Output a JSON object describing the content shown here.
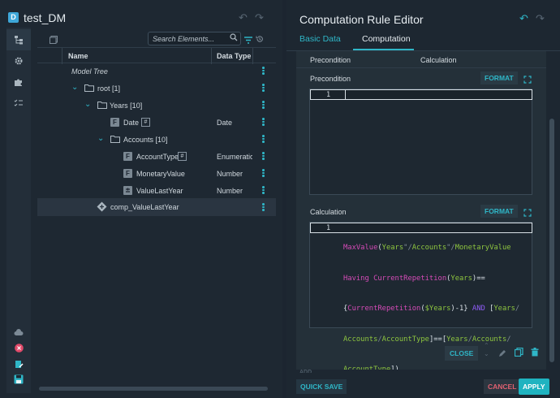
{
  "app": {
    "title": "test_DM",
    "logo_letter": "D"
  },
  "tree": {
    "search_placeholder": "Search Elements...",
    "columns": {
      "name": "Name",
      "data_type": "Data Type"
    },
    "root_label": "Model Tree",
    "rows": [
      {
        "label": "root [1]",
        "type": ""
      },
      {
        "label": "Years [10]",
        "type": ""
      },
      {
        "label": "Date",
        "type": "Date"
      },
      {
        "label": "Accounts [10]",
        "type": ""
      },
      {
        "label": "AccountType",
        "type": "Enumeratio"
      },
      {
        "label": "MonetaryValue",
        "type": "Number"
      },
      {
        "label": "ValueLastYear",
        "type": "Number"
      },
      {
        "label": "comp_ValueLastYear",
        "type": ""
      }
    ],
    "hash_symbol": "#",
    "f_letter": "F"
  },
  "editor": {
    "title": "Computation Rule Editor",
    "tabs": [
      "Basic Data",
      "Computation"
    ],
    "active_tab": "Computation",
    "sub_columns": {
      "precondition": "Precondition",
      "calculation": "Calculation"
    },
    "precondition": {
      "label": "Precondition",
      "format": "FORMAT",
      "line_no": "1"
    },
    "calculation": {
      "label": "Calculation",
      "format": "FORMAT",
      "line_no": "1",
      "code_lines": [
        "MaxValue(Years\"/Accounts\"/MonetaryValue",
        "Having CurrentRepetition(Years)==",
        "{CurrentRepetition($Years)-1} AND [Years/",
        "Accounts/AccountType]==[Years/Accounts/",
        "AccountType])"
      ]
    },
    "close": "CLOSE",
    "add": "ADD",
    "quick_save": "QUICK SAVE",
    "cancel": "CANCEL",
    "apply": "APPLY"
  },
  "colors": {
    "accent": "#2fb6c7",
    "danger": "#e06070",
    "apply_bg": "#1fb3c0"
  }
}
